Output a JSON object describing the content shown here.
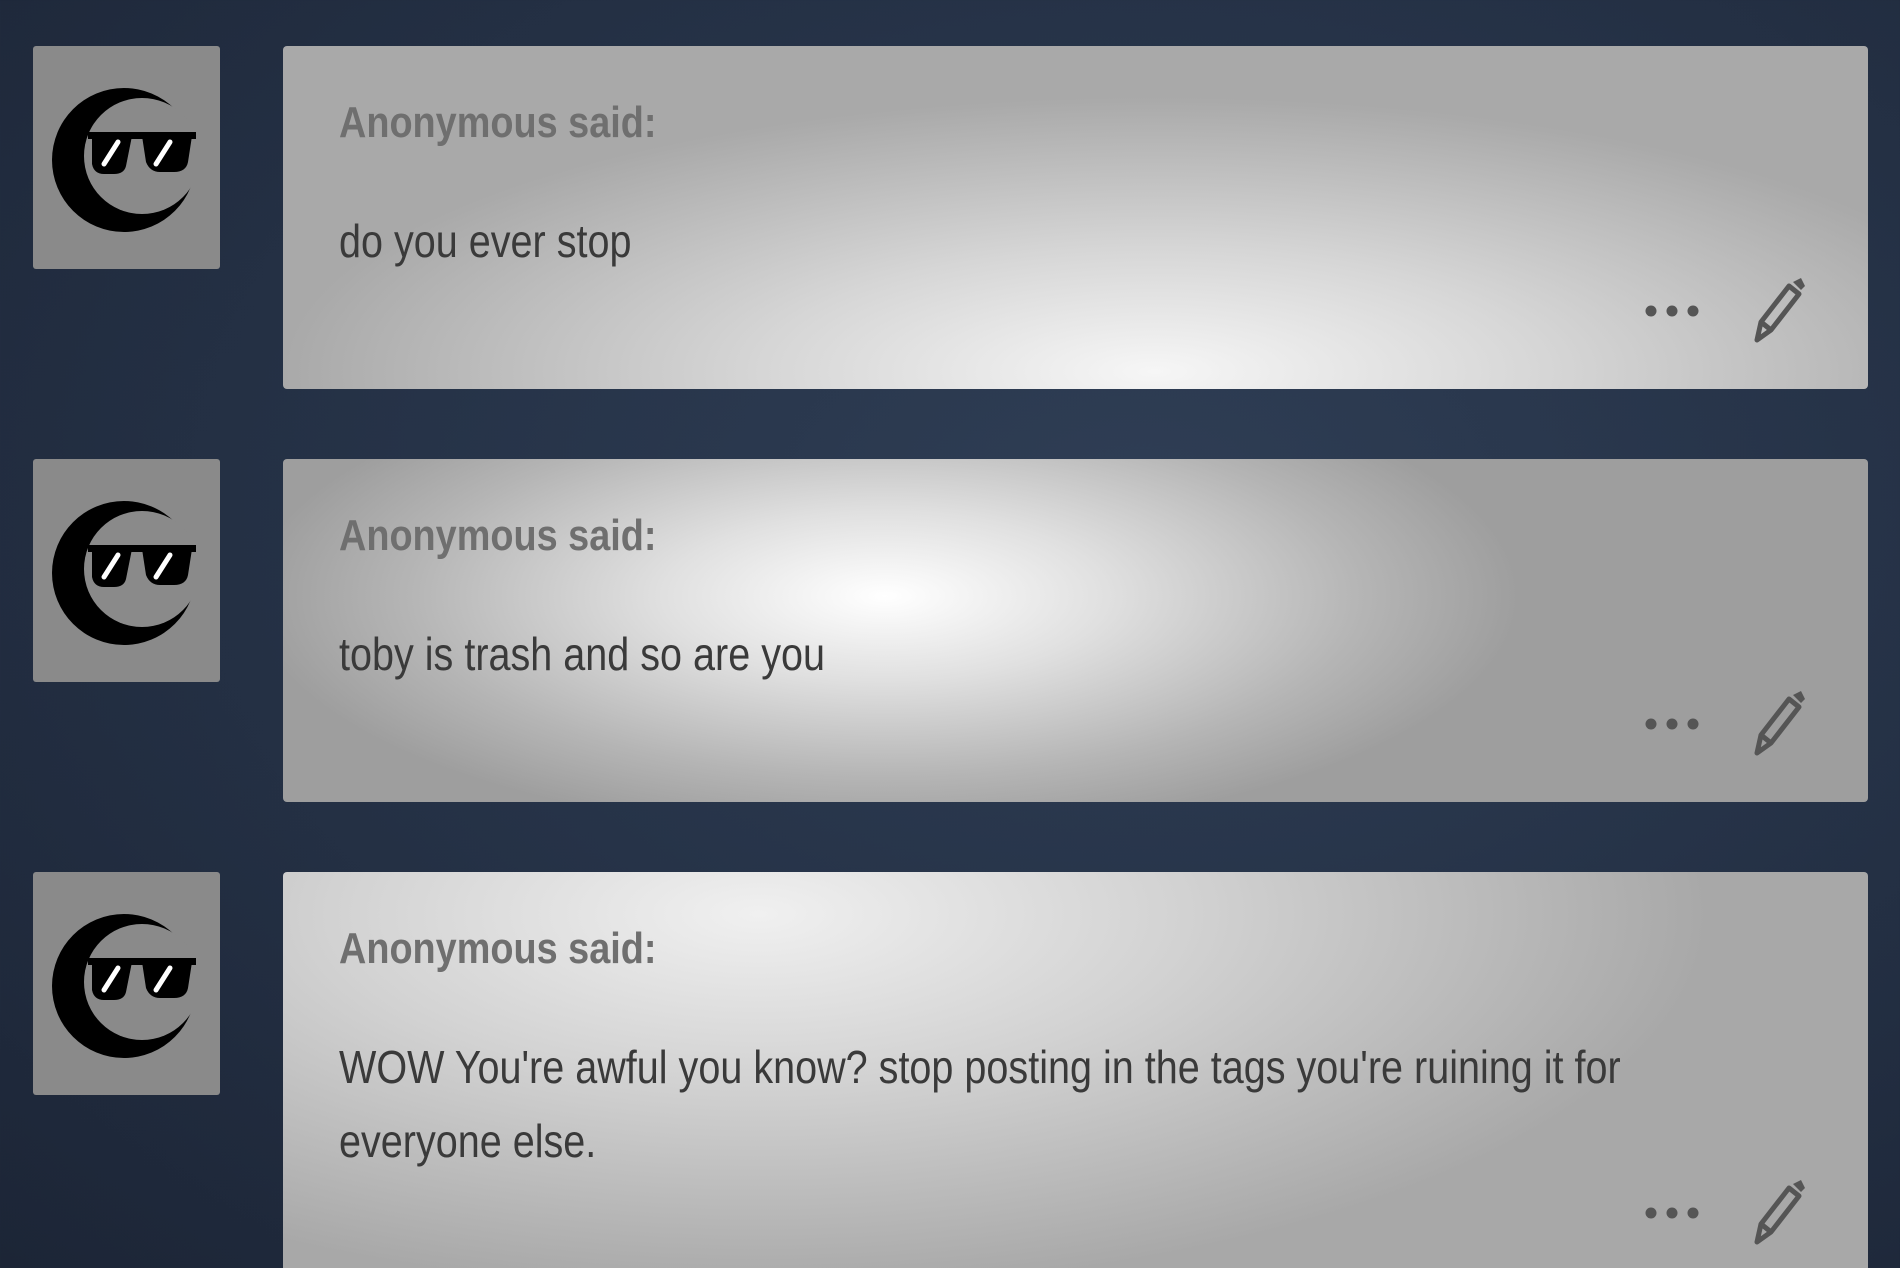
{
  "messages": [
    {
      "asker": "Anonymous said:",
      "text": "do you ever stop",
      "avatar_icon": "sunglasses-moon-icon",
      "more_icon": "more-dots-icon",
      "edit_icon": "pencil-icon"
    },
    {
      "asker": "Anonymous said:",
      "text": "toby is trash and so are you",
      "avatar_icon": "sunglasses-moon-icon",
      "more_icon": "more-dots-icon",
      "edit_icon": "pencil-icon"
    },
    {
      "asker": "Anonymous said:",
      "text": "WOW You're awful you know? stop posting in the tags you're ruining it for everyone else.",
      "avatar_icon": "sunglasses-moon-icon",
      "more_icon": "more-dots-icon",
      "edit_icon": "pencil-icon"
    }
  ],
  "colors": {
    "background": "#263348",
    "avatar_bg": "#8a8a8a",
    "asker_text": "#6f6f6f",
    "body_text": "#3a3a3a",
    "icon": "#555555"
  }
}
